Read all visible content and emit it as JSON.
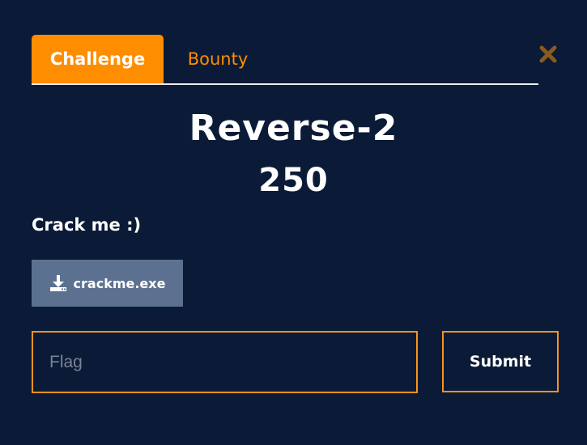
{
  "tabs": [
    {
      "label": "Challenge",
      "active": true
    },
    {
      "label": "Bounty",
      "active": false
    }
  ],
  "close_icon": "close-icon",
  "challenge": {
    "title": "Reverse-2",
    "points": "250",
    "description": "Crack me :)"
  },
  "file": {
    "icon": "download-icon",
    "name": "crackme.exe"
  },
  "flag_input": {
    "placeholder": "Flag",
    "value": ""
  },
  "submit_label": "Submit",
  "colors": {
    "background": "#0b1b37",
    "accent": "#ff8d00",
    "file_button": "#5c7190",
    "close_icon": "#8a5a1f"
  }
}
